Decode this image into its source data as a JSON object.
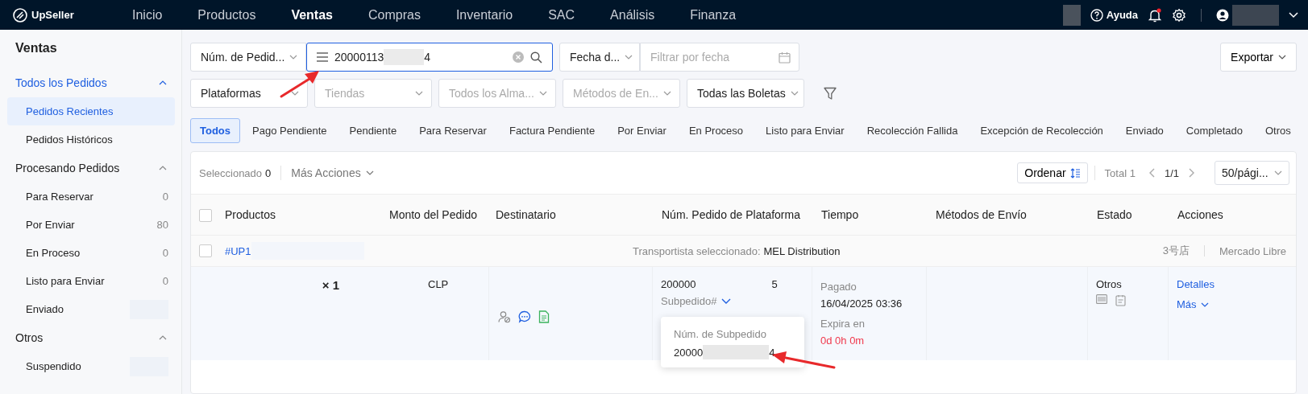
{
  "topbar": {
    "logo": "UpSeller",
    "nav": [
      {
        "label": "Inicio",
        "selected": false
      },
      {
        "label": "Productos",
        "selected": false
      },
      {
        "label": "Ventas",
        "selected": true
      },
      {
        "label": "Compras",
        "selected": false
      },
      {
        "label": "Inventario",
        "selected": false
      },
      {
        "label": "SAC",
        "selected": false
      },
      {
        "label": "Análisis",
        "selected": false
      },
      {
        "label": "Finanza",
        "selected": false
      }
    ],
    "help": "Ayuda",
    "unread_notifications": true
  },
  "sidebar": {
    "title": "Ventas",
    "groups": [
      {
        "label": "Todos los Pedidos",
        "selected": true,
        "expanded": true,
        "items": [
          {
            "label": "Pedidos Recientes",
            "selected": true
          },
          {
            "label": "Pedidos Históricos",
            "selected": false
          }
        ]
      },
      {
        "label": "Procesando Pedidos",
        "selected": false,
        "expanded": true,
        "items": [
          {
            "label": "Para Reservar",
            "count": "0",
            "selected": false
          },
          {
            "label": "Por Enviar",
            "count": "80",
            "selected": false
          },
          {
            "label": "En Proceso",
            "count": "0",
            "selected": false
          },
          {
            "label": "Listo para Enviar",
            "count": "0",
            "selected": false
          },
          {
            "label": "Enviado",
            "count_hidden": true,
            "selected": false
          }
        ]
      },
      {
        "label": "Otros",
        "selected": false,
        "expanded": true,
        "items": [
          {
            "label": "Suspendido",
            "count_hidden": true,
            "selected": false
          }
        ]
      }
    ]
  },
  "filters": {
    "row_1": [
      {
        "kind": "select",
        "value": "Núm. de Pedid..."
      },
      {
        "kind": "search",
        "value_start": "20000113",
        "value_end": "4"
      },
      {
        "kind": "select",
        "value": "Fecha d..."
      },
      {
        "kind": "date",
        "placeholder": "Filtrar por fecha"
      }
    ],
    "export": "Exportar",
    "row_2": [
      {
        "kind": "select",
        "value": "Plataformas"
      },
      {
        "kind": "select",
        "placeholder": "Tiendas"
      },
      {
        "kind": "select",
        "placeholder": "Todos los Alma..."
      },
      {
        "kind": "select",
        "placeholder": "Métodos de En..."
      },
      {
        "kind": "select",
        "value": "Todas las Boletas"
      }
    ]
  },
  "tabs": [
    {
      "label": "Todos",
      "selected": true
    },
    {
      "label": "Pago Pendiente",
      "selected": false
    },
    {
      "label": "Pendiente",
      "selected": false
    },
    {
      "label": "Para Reservar",
      "selected": false
    },
    {
      "label": "Factura Pendiente",
      "selected": false
    },
    {
      "label": "Por Enviar",
      "selected": false
    },
    {
      "label": "En Proceso",
      "selected": false
    },
    {
      "label": "Listo para Enviar",
      "selected": false
    },
    {
      "label": "Recolección Fallida",
      "selected": false
    },
    {
      "label": "Excepción de Recolección",
      "selected": false
    },
    {
      "label": "Enviado",
      "selected": false
    },
    {
      "label": "Completado",
      "selected": false
    },
    {
      "label": "Otros",
      "selected": false
    }
  ],
  "toolbar": {
    "selected_label": "Seleccionado",
    "selected_count": "0",
    "more_actions": "Más Acciones",
    "sort": "Ordenar",
    "total": "Total 1",
    "page": "1/1",
    "page_size": "50/pági..."
  },
  "table": {
    "all_checked": false,
    "columns": [
      "Productos",
      "Monto del Pedido",
      "Destinatario",
      "Núm. Pedido de Plataforma",
      "Tiempo",
      "Métodos de Envío",
      "Estado",
      "Acciones"
    ],
    "orders": [
      {
        "checked": false,
        "order_no": "#UP1",
        "carrier_label": "Transportista seleccionado:",
        "carrier": "MEL Distribution",
        "store": "3号店",
        "platform": "Mercado Libre",
        "quantity": "× 1",
        "amount": "CLP",
        "platform_order_start": "200000",
        "platform_order_end": "5",
        "suborder": "Subpedido#",
        "payment_status": "Pagado",
        "paid_time": "16/04/2025 03:36",
        "expiry_label": "Expira en",
        "expiry": "0d 0h 0m",
        "status": "Otros",
        "actions": [
          "Detalles",
          "Más"
        ],
        "popover": {
          "title": "Núm. de Subpedido",
          "value_start": "20000",
          "value_end": "4"
        }
      }
    ]
  }
}
